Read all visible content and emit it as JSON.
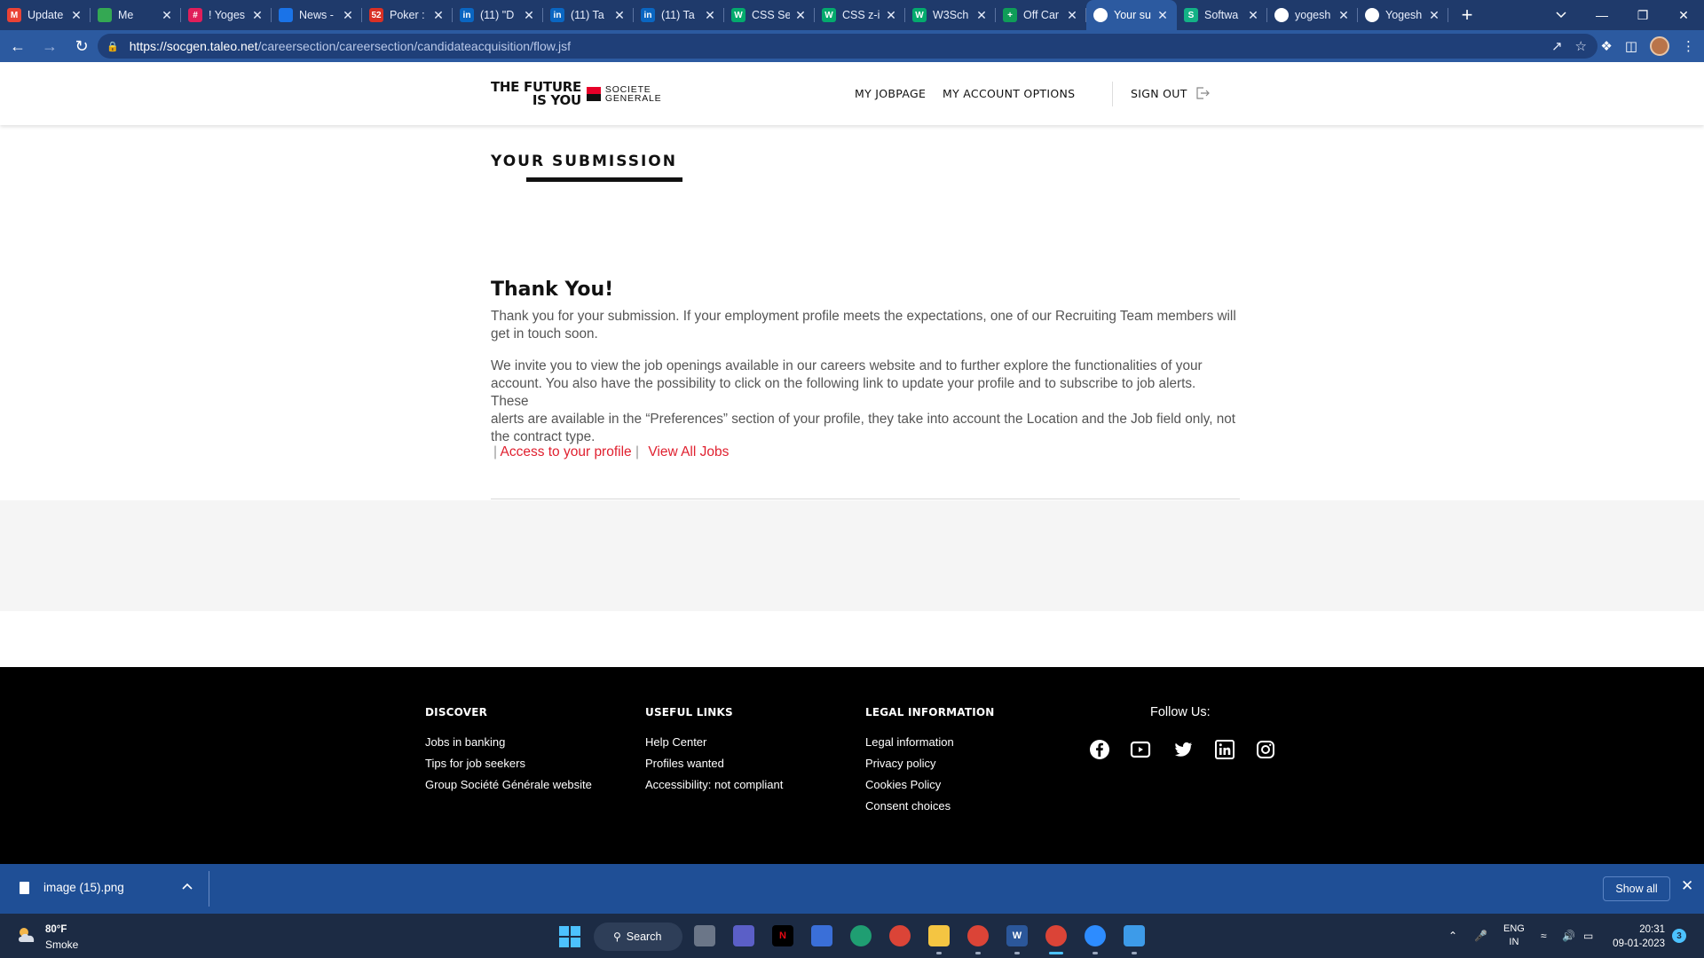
{
  "browser": {
    "tabs": [
      {
        "title": "Update",
        "fav": "M",
        "color": "#ea4335"
      },
      {
        "title": "Me",
        "fav": "",
        "color": "#34a853"
      },
      {
        "title": "! Yoges",
        "fav": "#",
        "color": "#e01e5a"
      },
      {
        "title": "News -",
        "fav": "",
        "color": "#1a73e8"
      },
      {
        "title": "Poker :",
        "fav": "52",
        "color": "#d93025"
      },
      {
        "title": "(11) \"D",
        "fav": "in",
        "color": "#0a66c2"
      },
      {
        "title": "(11) Ta",
        "fav": "in",
        "color": "#0a66c2"
      },
      {
        "title": "(11) Ta",
        "fav": "in",
        "color": "#0a66c2"
      },
      {
        "title": "CSS Se",
        "fav": "W",
        "color": "#04aa6d"
      },
      {
        "title": "CSS z-i",
        "fav": "W",
        "color": "#04aa6d"
      },
      {
        "title": "W3Sch",
        "fav": "W",
        "color": "#04aa6d"
      },
      {
        "title": "Off Car",
        "fav": "+",
        "color": "#0f9d58"
      },
      {
        "title": "Your su",
        "fav": "",
        "color": "#ffffff",
        "active": true
      },
      {
        "title": "Softwa",
        "fav": "S",
        "color": "#13b286"
      },
      {
        "title": "yogesh",
        "fav": "",
        "color": "#ffffff"
      },
      {
        "title": "Yogesh",
        "fav": "",
        "color": "#ffffff"
      }
    ],
    "new_tab": "+",
    "url_host": "https://socgen.taleo.net",
    "url_path": "/careersection/careersection/candidateacquisition/flow.jsf"
  },
  "site": {
    "logo_line1": "THE FUTURE",
    "logo_line2": "IS YOU",
    "brand_line1": "SOCIETE",
    "brand_line2": "GENERALE",
    "nav": {
      "jobpage": "MY JOBPAGE",
      "account": "MY ACCOUNT OPTIONS",
      "signout": "SIGN OUT"
    },
    "section_title": "YOUR SUBMISSION",
    "thanks_heading": "Thank You!",
    "para1_line1": "Thank you for your submission. If your employment profile meets the expectations, one of our Recruiting Team members will",
    "para1_line2": "get in touch soon.",
    "para2_line1": "We invite you to view the job openings available in our careers website and to further explore the functionalities of your",
    "para2_line2": "account. You also have the possibility to click on the following link to update your profile and to subscribe to job alerts. These",
    "para2_line3": "alerts are available in the “Preferences” section of your profile, they take into account the Location and the Job field only, not",
    "para2_line4": "the contract type.",
    "pipe": "|",
    "link_profile": "Access to your profile",
    "link_jobs": "View All Jobs"
  },
  "footer": {
    "discover": {
      "heading": "DISCOVER",
      "items": [
        "Jobs in banking",
        "Tips for job seekers",
        "Group Société Générale website"
      ]
    },
    "useful": {
      "heading": "USEFUL LINKS",
      "items": [
        "Help Center",
        "Profiles wanted",
        "Accessibility: not compliant"
      ]
    },
    "legal": {
      "heading": "LEGAL INFORMATION",
      "items": [
        "Legal information",
        "Privacy policy",
        "Cookies Policy",
        "Consent choices"
      ]
    },
    "follow": "Follow Us:",
    "social_icons": [
      "facebook-icon",
      "youtube-icon",
      "twitter-icon",
      "linkedin-icon",
      "instagram-icon"
    ]
  },
  "downloads": {
    "file_name": "image (15).png",
    "show_all": "Show all"
  },
  "taskbar": {
    "temperature": "80°F",
    "weather": "Smoke",
    "search": "Search",
    "lang1": "ENG",
    "lang2": "IN",
    "time": "20:31",
    "date": "09-01-2023",
    "notifications": "3"
  }
}
